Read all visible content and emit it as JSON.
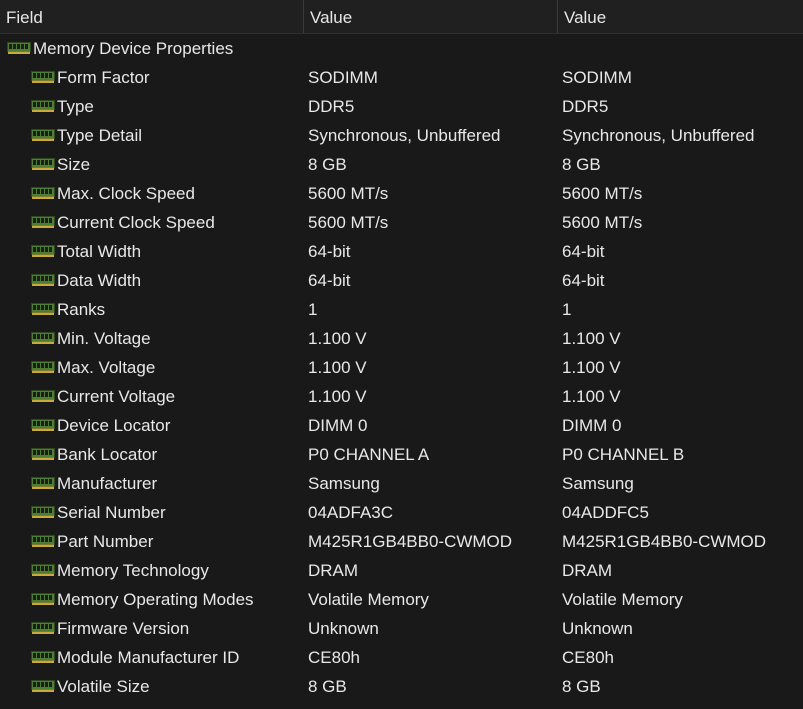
{
  "header": {
    "field": "Field",
    "value1": "Value",
    "value2": "Value"
  },
  "group": {
    "label": "Memory Device Properties",
    "icon": "memory-module-icon"
  },
  "rows": [
    {
      "field": "Form Factor",
      "v1": "SODIMM",
      "v2": "SODIMM"
    },
    {
      "field": "Type",
      "v1": "DDR5",
      "v2": "DDR5"
    },
    {
      "field": "Type Detail",
      "v1": "Synchronous, Unbuffered",
      "v2": "Synchronous, Unbuffered"
    },
    {
      "field": "Size",
      "v1": "8 GB",
      "v2": "8 GB"
    },
    {
      "field": "Max. Clock Speed",
      "v1": "5600 MT/s",
      "v2": "5600 MT/s"
    },
    {
      "field": "Current Clock Speed",
      "v1": "5600 MT/s",
      "v2": "5600 MT/s"
    },
    {
      "field": "Total Width",
      "v1": "64-bit",
      "v2": "64-bit"
    },
    {
      "field": "Data Width",
      "v1": "64-bit",
      "v2": "64-bit"
    },
    {
      "field": "Ranks",
      "v1": "1",
      "v2": "1"
    },
    {
      "field": "Min. Voltage",
      "v1": "1.100 V",
      "v2": "1.100 V"
    },
    {
      "field": "Max. Voltage",
      "v1": "1.100 V",
      "v2": "1.100 V"
    },
    {
      "field": "Current Voltage",
      "v1": "1.100 V",
      "v2": "1.100 V"
    },
    {
      "field": "Device Locator",
      "v1": "DIMM 0",
      "v2": "DIMM 0"
    },
    {
      "field": "Bank Locator",
      "v1": "P0 CHANNEL A",
      "v2": "P0 CHANNEL B"
    },
    {
      "field": "Manufacturer",
      "v1": "Samsung",
      "v2": "Samsung"
    },
    {
      "field": "Serial Number",
      "v1": "04ADFA3C",
      "v2": "04ADDFC5"
    },
    {
      "field": "Part Number",
      "v1": "M425R1GB4BB0-CWMOD",
      "v2": "M425R1GB4BB0-CWMOD"
    },
    {
      "field": "Memory Technology",
      "v1": "DRAM",
      "v2": "DRAM"
    },
    {
      "field": "Memory Operating Modes",
      "v1": "Volatile Memory",
      "v2": "Volatile Memory"
    },
    {
      "field": "Firmware Version",
      "v1": "Unknown",
      "v2": "Unknown"
    },
    {
      "field": "Module Manufacturer ID",
      "v1": "CE80h",
      "v2": "CE80h"
    },
    {
      "field": "Volatile Size",
      "v1": "8 GB",
      "v2": "8 GB"
    }
  ],
  "colors": {
    "background": "#191919",
    "header_background": "#202020",
    "text": "#e8e8e8",
    "module_green": "#5a8a3a"
  }
}
